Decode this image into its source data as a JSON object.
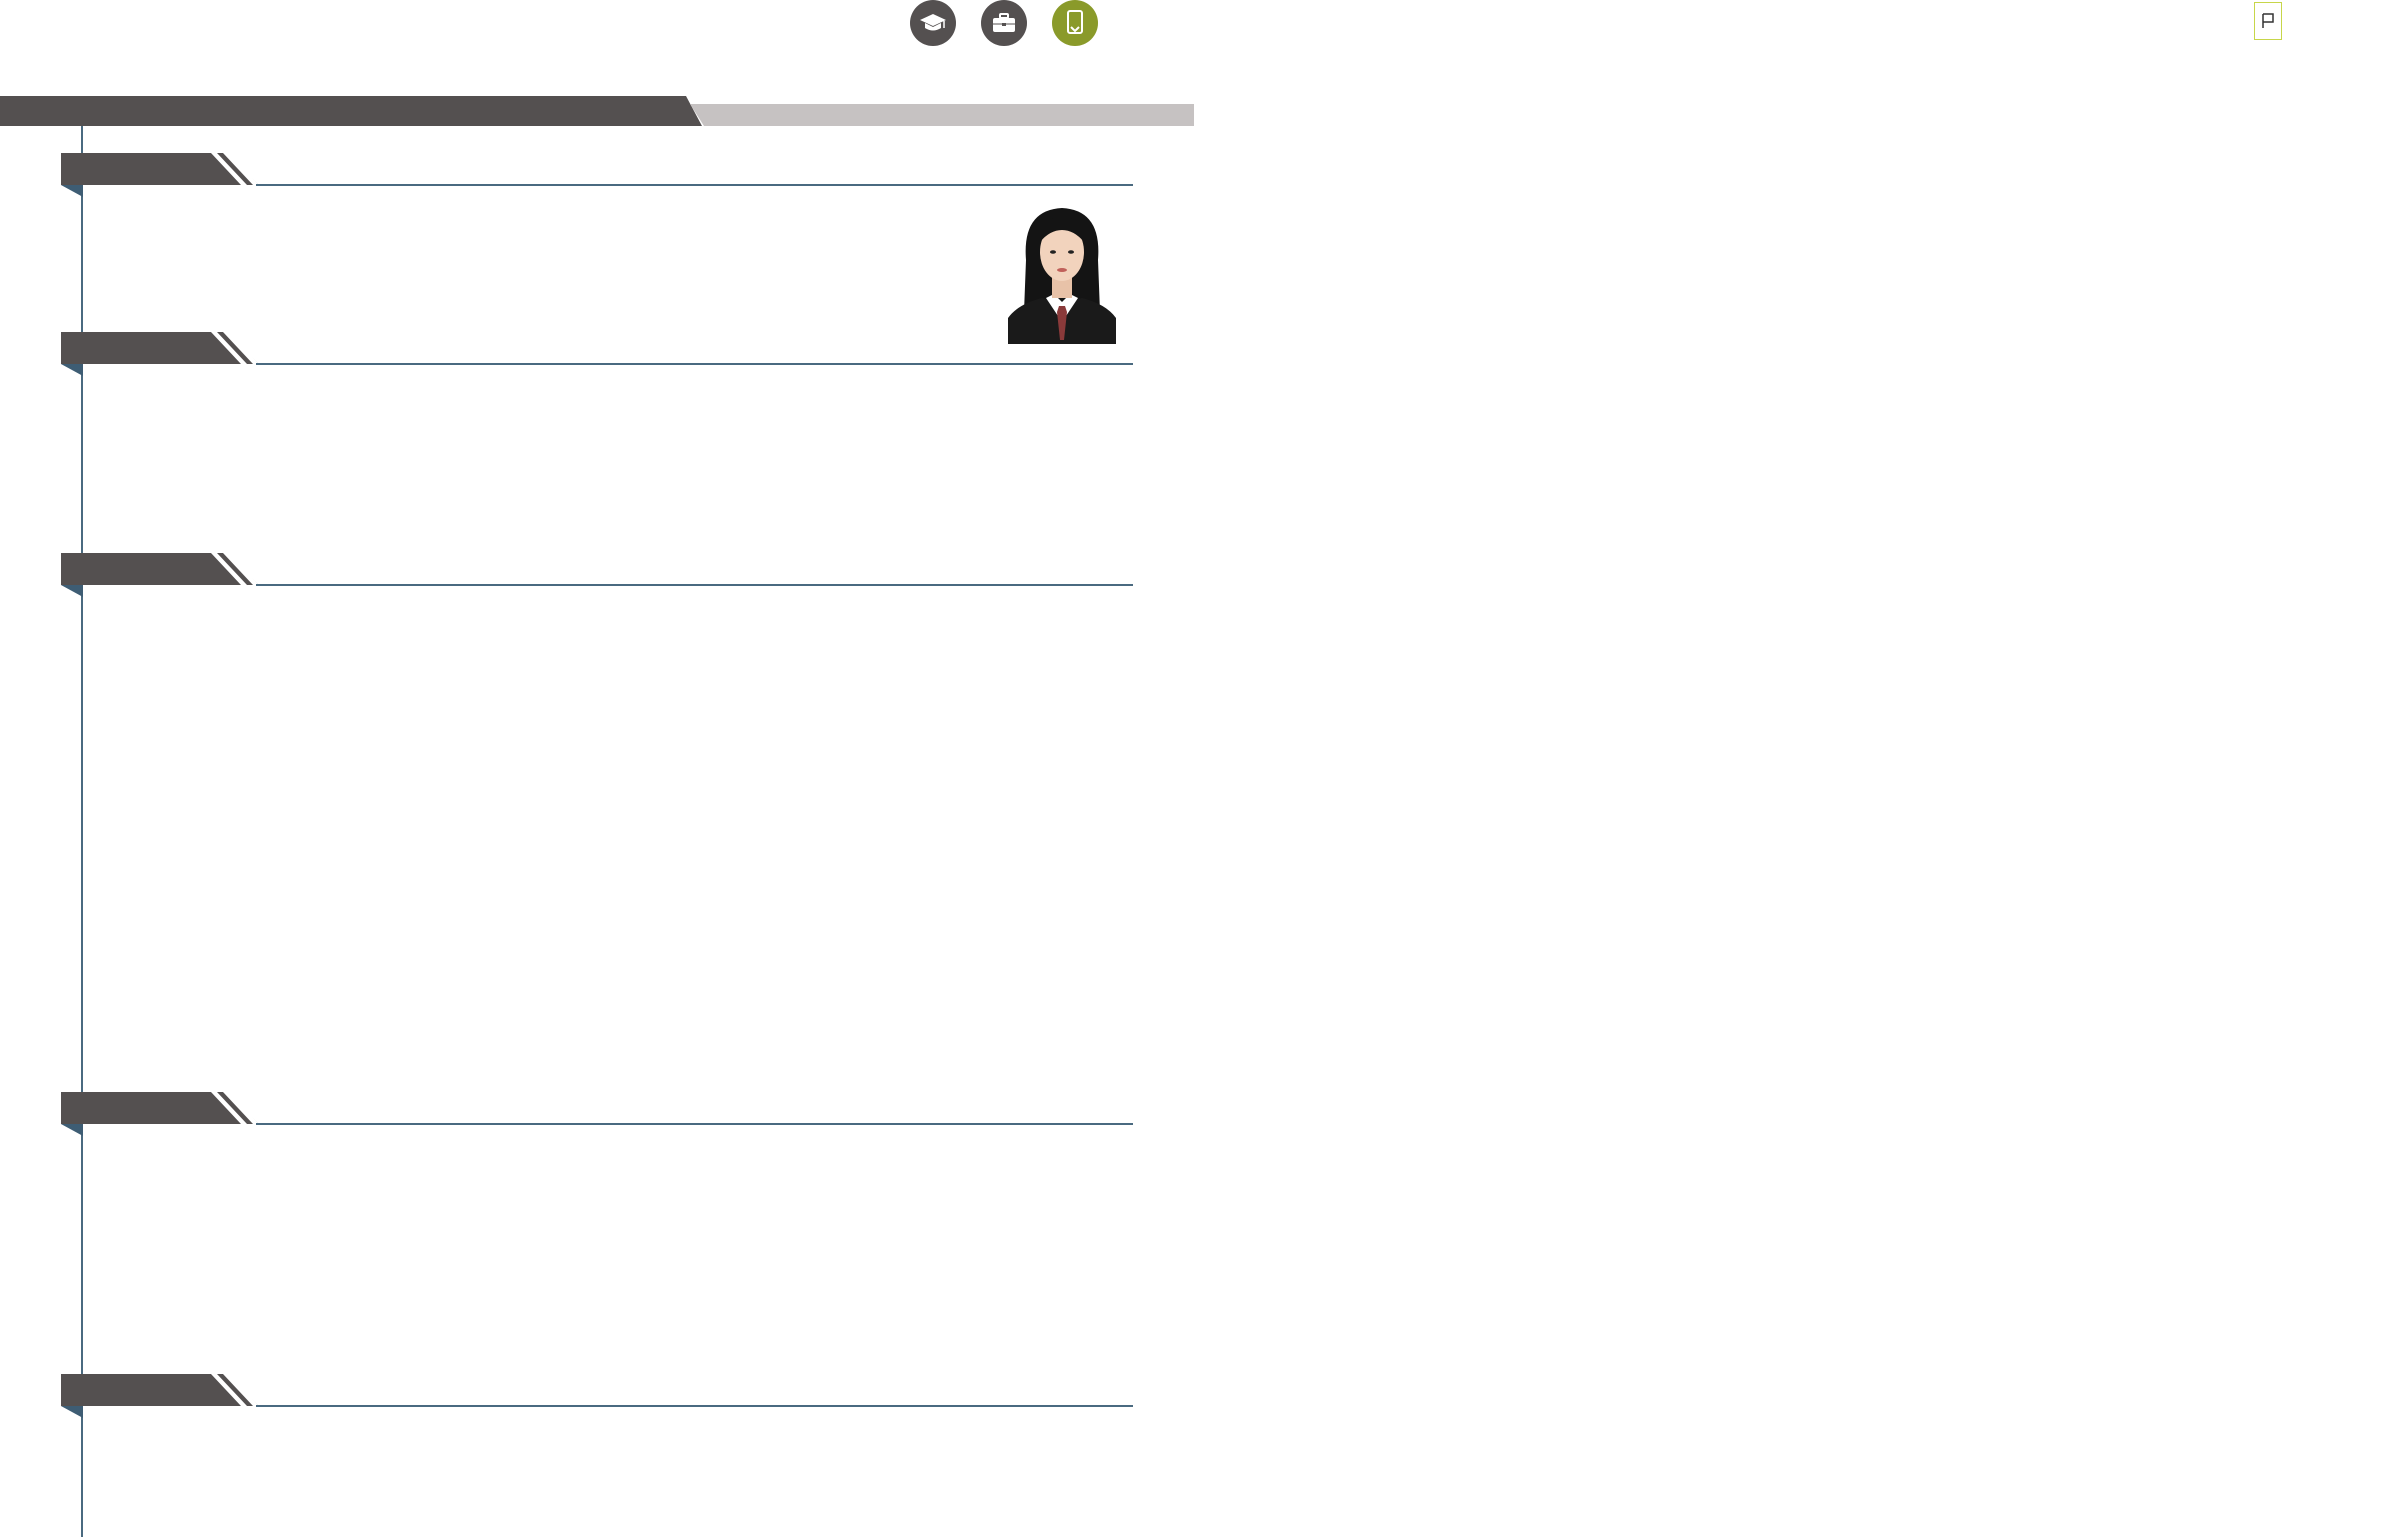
{
  "icons": {
    "education": "graduation-cap-icon",
    "work": "briefcase-icon",
    "honors": "bookmark-icon",
    "flag": "flag-icon"
  },
  "colors": {
    "dark_band": "#545050",
    "light_band": "#c6c2c2",
    "accent_line": "#4a6a80",
    "highlight_icon": "#8a9a2a",
    "flag_border": "#c7d64a"
  },
  "sections": [
    {
      "title": ""
    },
    {
      "title": ""
    },
    {
      "title": ""
    },
    {
      "title": ""
    },
    {
      "title": ""
    }
  ]
}
